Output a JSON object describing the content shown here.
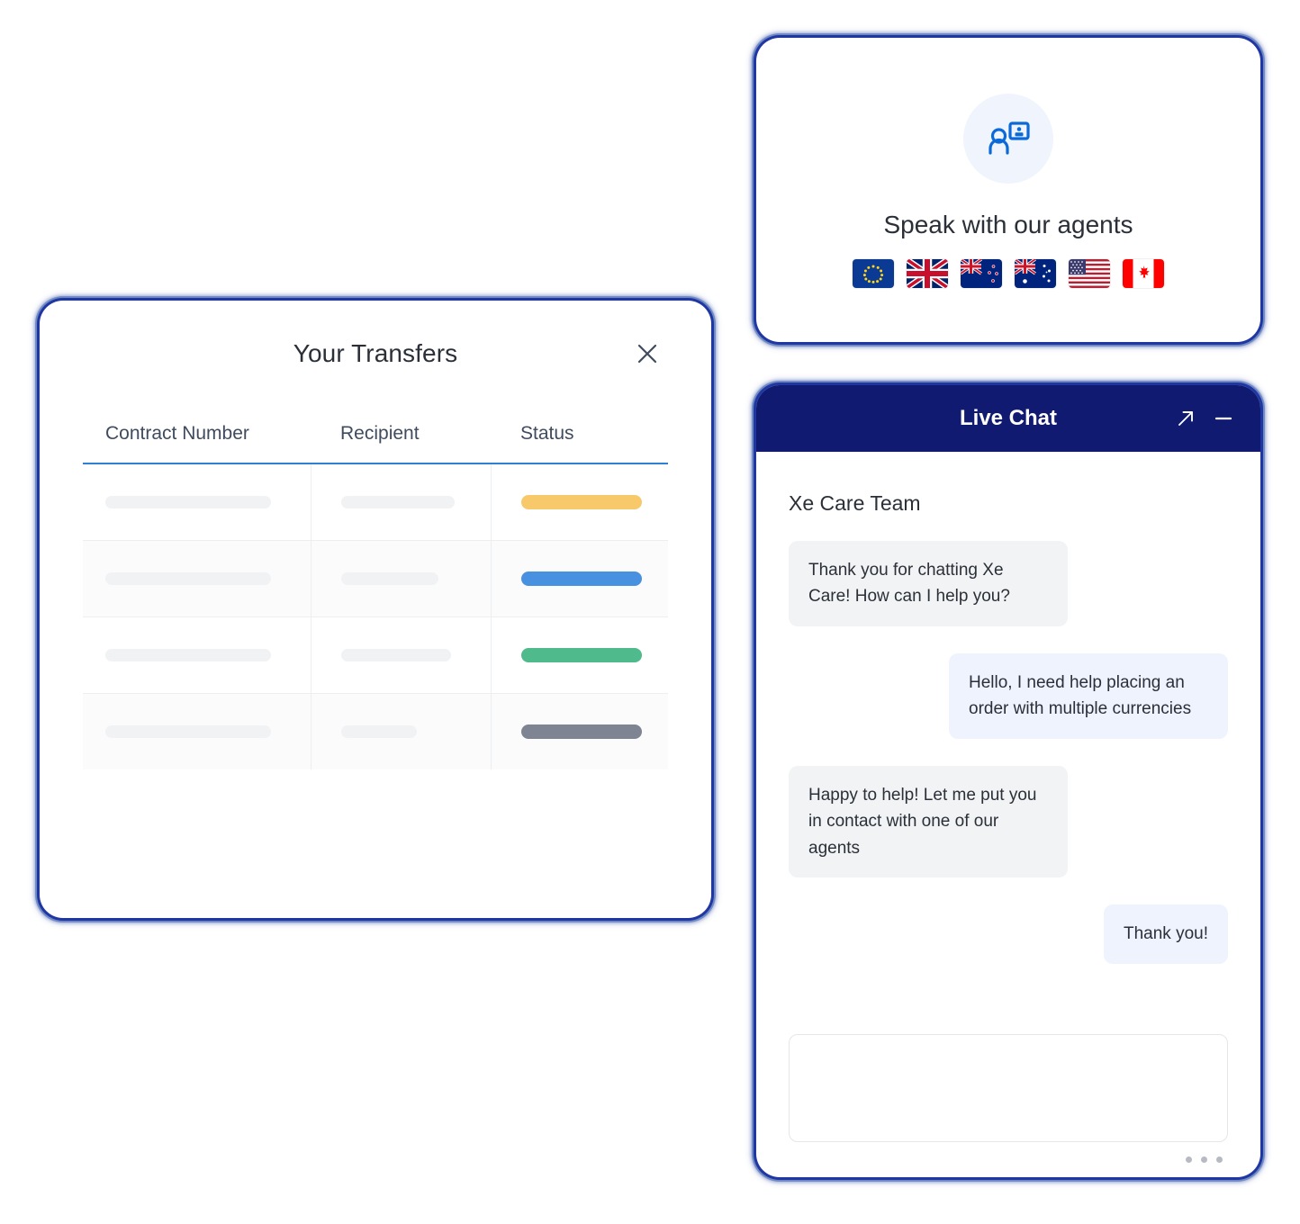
{
  "panels": {
    "top_left": {
      "name": "blank-panel"
    },
    "bottom_left": {
      "name": "blank-panel"
    }
  },
  "transfers": {
    "title": "Your Transfers",
    "close_icon": "close-icon",
    "columns": [
      "Contract Number",
      "Recipient",
      "Status"
    ],
    "rows": [
      {
        "contract_width": 184,
        "recipient_width": 126,
        "status_color": "#f7c96b",
        "status_width": 134
      },
      {
        "contract_width": 184,
        "recipient_width": 108,
        "status_color": "#4891e0",
        "status_width": 134
      },
      {
        "contract_width": 184,
        "recipient_width": 122,
        "status_color": "#4fba8b",
        "status_width": 134
      },
      {
        "contract_width": 184,
        "recipient_width": 84,
        "status_color": "#7e8492",
        "status_width": 134
      }
    ],
    "header_rule_color": "#2f7fd4"
  },
  "agents": {
    "icon": "agent-badge-icon",
    "title": "Speak with our agents",
    "flags": [
      {
        "name": "flag-european-union",
        "label": "European Union"
      },
      {
        "name": "flag-united-kingdom",
        "label": "United Kingdom"
      },
      {
        "name": "flag-new-zealand",
        "label": "New Zealand"
      },
      {
        "name": "flag-australia",
        "label": "Australia"
      },
      {
        "name": "flag-united-states",
        "label": "United States"
      },
      {
        "name": "flag-canada",
        "label": "Canada"
      }
    ]
  },
  "chat": {
    "title": "Live Chat",
    "header_color": "#101a70",
    "expand_icon": "expand-arrow-icon",
    "minimize_icon": "minimize-icon",
    "team_label": "Xe Care Team",
    "messages": [
      {
        "from": "agent",
        "text": "Thank you for chatting Xe Care! How can I help you?"
      },
      {
        "from": "user",
        "text": "Hello, I need help placing an order with multiple currencies"
      },
      {
        "from": "agent",
        "text": "Happy to help! Let me put you in contact with one of our agents"
      },
      {
        "from": "user",
        "text": "Thank you!"
      }
    ],
    "input_placeholder": "",
    "typing_indicator": "typing-dots"
  }
}
